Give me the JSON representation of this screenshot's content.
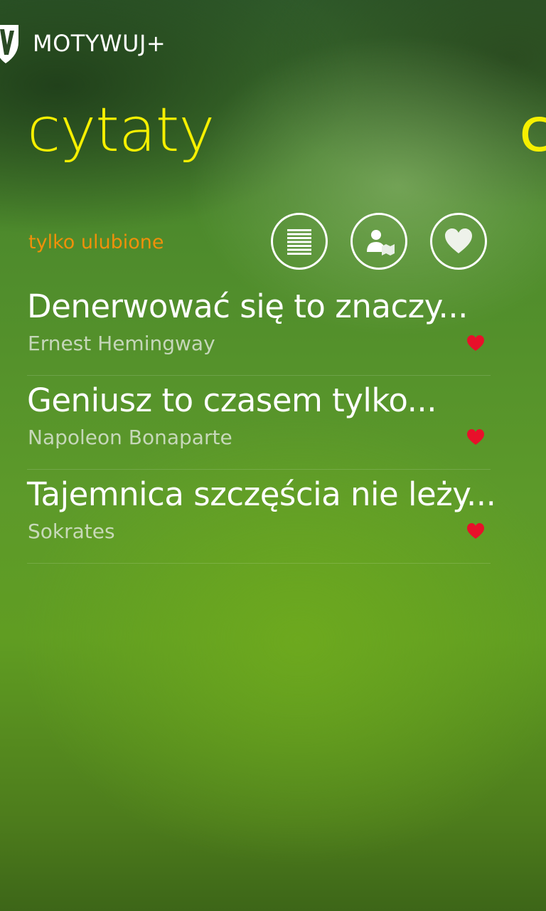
{
  "app": {
    "title": "MOTYWUJ+"
  },
  "pivot": {
    "current": "cytaty",
    "next_peek": "c"
  },
  "filter": {
    "label": "tylko ulubione"
  },
  "toolbar": {
    "icons": [
      "list-icon",
      "author-icon",
      "heart-icon"
    ]
  },
  "quotes": [
    {
      "title": "Denerwować się to znaczy...",
      "author": "Ernest Hemingway",
      "favorite": true
    },
    {
      "title": "Geniusz to czasem tylko...",
      "author": "Napoleon Bonaparte",
      "favorite": true
    },
    {
      "title": "Tajemnica szczęścia nie leży...",
      "author": "Sokrates",
      "favorite": true
    }
  ],
  "colors": {
    "accent": "#f6f000",
    "filter": "#f0900a",
    "heart": "#e8102a"
  }
}
